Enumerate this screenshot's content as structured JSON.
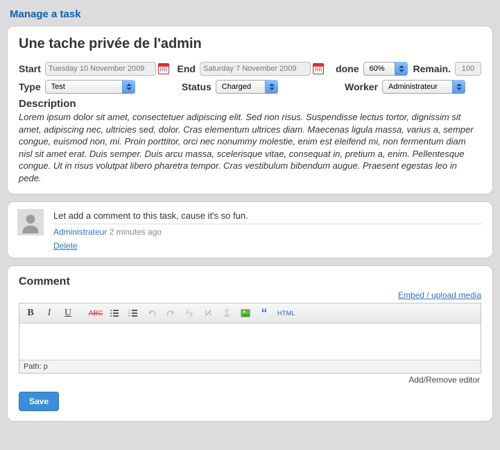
{
  "page_title": "Manage a task",
  "task": {
    "title": "Une tache privée de l'admin",
    "start": {
      "label": "Start",
      "value": "Tuesday 10 November 2009"
    },
    "end": {
      "label": "End",
      "value": "Saturday 7 November 2009"
    },
    "done": {
      "label": "done",
      "value": "60%"
    },
    "remain": {
      "label": "Remain.",
      "value": "100"
    },
    "type": {
      "label": "Type",
      "value": "Test"
    },
    "status": {
      "label": "Status",
      "value": "Charged"
    },
    "worker": {
      "label": "Worker",
      "value": "Administrateur"
    },
    "description_label": "Description",
    "description_body": "Lorem ipsum dolor sit amet, consectetuer adipiscing elit. Sed non risus. Suspendisse lectus tortor, dignissim sit amet, adipiscing nec, ultricies sed, dolor. Cras elementum ultrices diam. Maecenas ligula massa, varius a, semper congue, euismod non, mi. Proin porttitor, orci nec nonummy molestie, enim est eleifend mi, non fermentum diam nisl sit amet erat. Duis semper. Duis arcu massa, scelerisque vitae, consequat in, pretium a, enim. Pellentesque congue. Ut in risus volutpat libero pharetra tempor. Cras vestibulum bibendum augue. Praesent egestas leo in pede."
  },
  "comment_list": {
    "comment_text": "Let add a comment to this task, cause it's so fun.",
    "author": "Administrateur",
    "time": "2 minutes ago",
    "delete_label": "Delete"
  },
  "comment_form": {
    "heading": "Comment",
    "media_link": "Embed / upload media",
    "toolbar": {
      "bold": "B",
      "italic": "I",
      "underline": "U",
      "strike": "ABC",
      "html": "HTML"
    },
    "path_label": "Path: p",
    "toggle_label": "Add/Remove editor",
    "save_label": "Save"
  }
}
